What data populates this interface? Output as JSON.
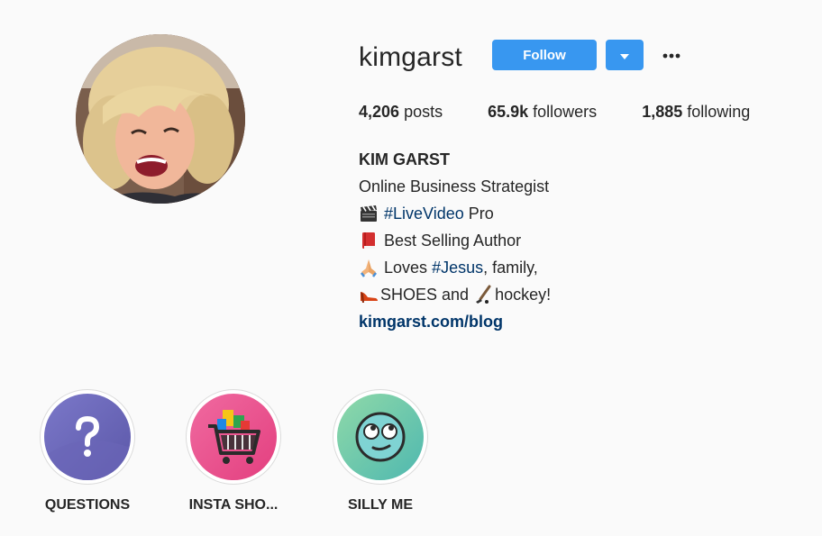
{
  "profile": {
    "username": "kimgarst",
    "follow_label": "Follow",
    "more_label": "···"
  },
  "stats": {
    "posts_count": "4,206",
    "posts_label": "posts",
    "followers_count": "65.9k",
    "followers_label": "followers",
    "following_count": "1,885",
    "following_label": "following"
  },
  "bio": {
    "full_name": "KIM GARST",
    "line1": "Online Business Strategist",
    "line2_hashtag": "#LiveVideo",
    "line2_rest": "Pro",
    "line3": "Best Selling Author",
    "line4_pre": "Loves",
    "line4_hashtag": "#Jesus",
    "line4_post": ", family,",
    "line5_pre": "SHOES and",
    "line5_post": "hockey!",
    "link": "kimgarst.com/blog",
    "icons": [
      "clapper-board-icon",
      "red-book-icon",
      "praying-hands-icon",
      "high-heel-icon",
      "hockey-stick-icon"
    ]
  },
  "highlights": [
    {
      "label": "QUESTIONS",
      "icon": "question-mark-icon"
    },
    {
      "label": "INSTA SHO...",
      "icon": "shopping-cart-icon"
    },
    {
      "label": "SILLY ME",
      "icon": "eye-roll-emoji-icon"
    }
  ],
  "colors": {
    "accent": "#3897f0",
    "link": "#003569",
    "background": "#fafafa"
  }
}
